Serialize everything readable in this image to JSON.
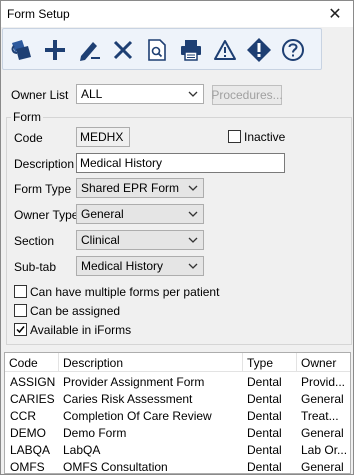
{
  "window": {
    "title": "Form Setup",
    "close_glyph": "✕"
  },
  "toolbar": {
    "buttons": [
      {
        "name": "attach-form-icon"
      },
      {
        "name": "add-icon"
      },
      {
        "name": "edit-icon"
      },
      {
        "name": "delete-icon"
      },
      {
        "name": "preview-icon"
      },
      {
        "name": "print-icon"
      },
      {
        "name": "warning-icon"
      },
      {
        "name": "alert-icon"
      },
      {
        "name": "help-icon"
      }
    ]
  },
  "owner_list": {
    "label": "Owner List",
    "value": "ALL",
    "procedures_button": "Procedures..."
  },
  "form": {
    "group_label": "Form",
    "code_label": "Code",
    "code_value": "MEDHX",
    "inactive_label": "Inactive",
    "inactive_checked": false,
    "description_label": "Description",
    "description_value": "Medical History",
    "form_type_label": "Form Type",
    "form_type_value": "Shared EPR Form",
    "owner_type_label": "Owner Type",
    "owner_type_value": "General",
    "section_label": "Section",
    "section_value": "Clinical",
    "subtab_label": "Sub-tab",
    "subtab_value": "Medical History",
    "multi_label": "Can have multiple forms per patient",
    "multi_checked": false,
    "assigned_label": "Can be assigned",
    "assigned_checked": false,
    "iforms_label": "Available in iForms",
    "iforms_checked": true
  },
  "grid": {
    "columns": [
      "Code",
      "Description",
      "Type",
      "Owner"
    ],
    "rows": [
      {
        "code": "ASSIGN",
        "description": "Provider Assignment Form",
        "type": "Dental",
        "owner": "Provid..."
      },
      {
        "code": "CARIES",
        "description": "Caries Risk Assessment",
        "type": "Dental",
        "owner": "General"
      },
      {
        "code": "CCR",
        "description": "Completion Of Care Review",
        "type": "Dental",
        "owner": "Treat..."
      },
      {
        "code": "DEMO",
        "description": "Demo Form",
        "type": "Dental",
        "owner": "General"
      },
      {
        "code": "LABQA",
        "description": "LabQA",
        "type": "Dental",
        "owner": "Lab Or..."
      },
      {
        "code": "OMFS",
        "description": "OMFS Consultation",
        "type": "Dental",
        "owner": "General"
      }
    ]
  }
}
